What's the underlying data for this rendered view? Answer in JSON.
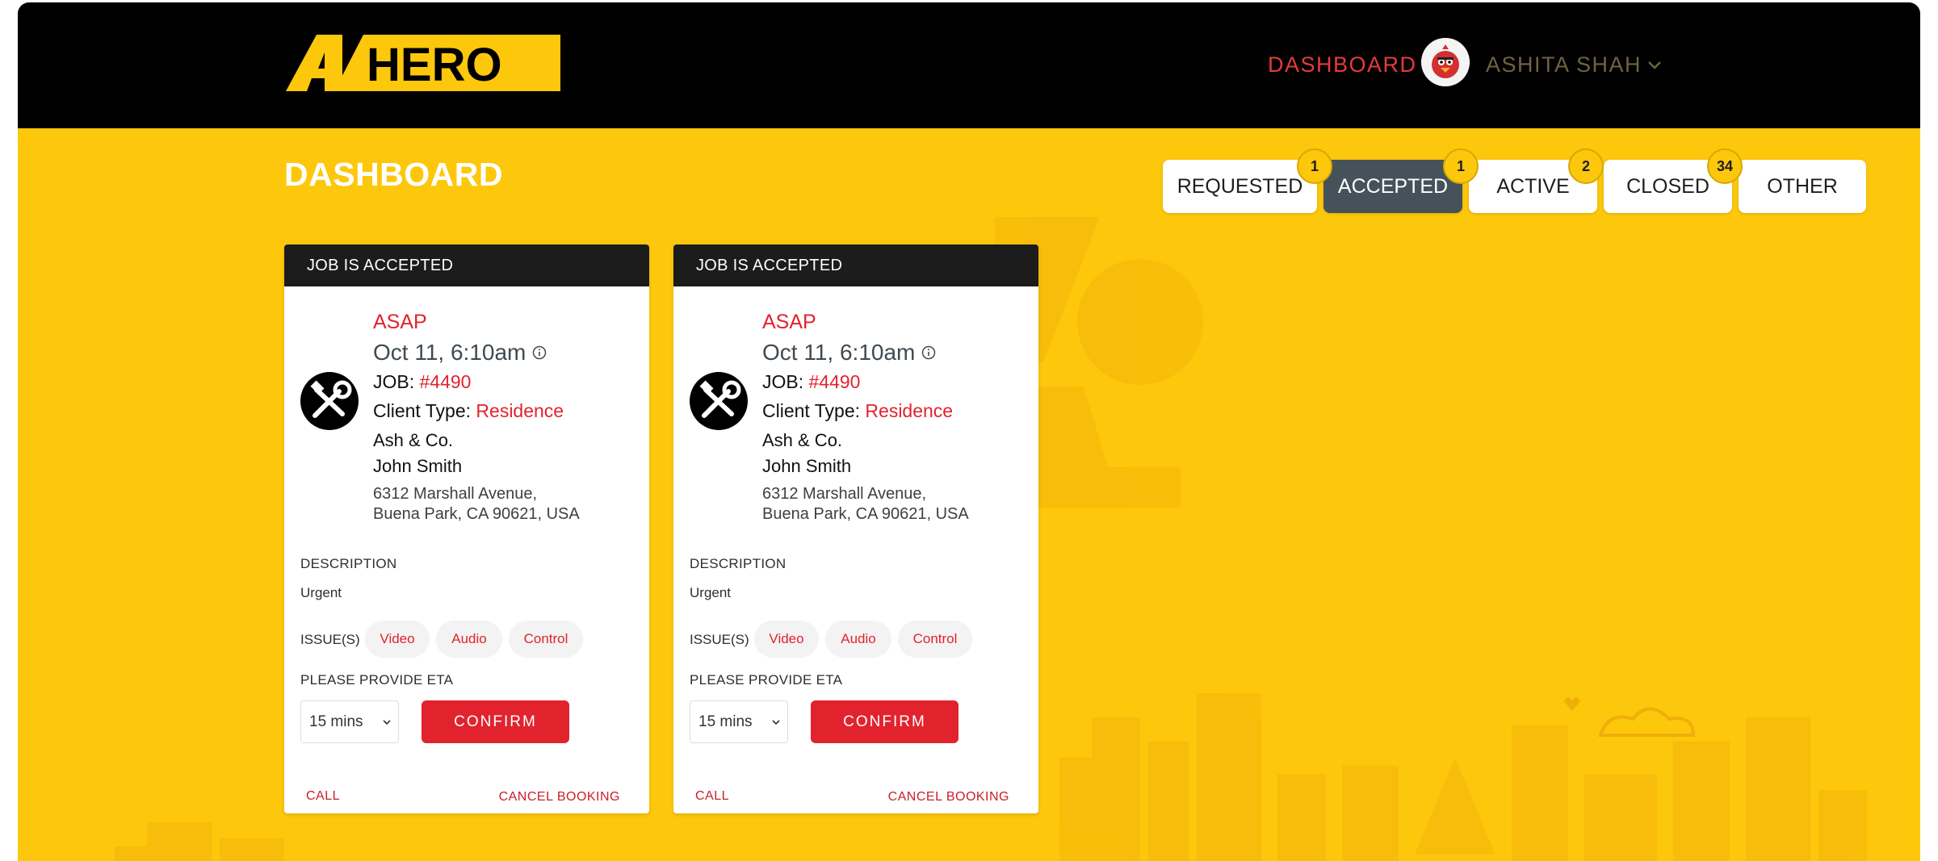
{
  "header": {
    "logo_text": "AV HERO",
    "nav_dashboard": "DASHBOARD",
    "user_name": "ASHITA SHAH"
  },
  "page": {
    "title": "DASHBOARD"
  },
  "tabs": [
    {
      "label": "REQUESTED",
      "badge": "1",
      "active": false
    },
    {
      "label": "ACCEPTED",
      "badge": "1",
      "active": true
    },
    {
      "label": "ACTIVE",
      "badge": "2",
      "active": false
    },
    {
      "label": "CLOSED",
      "badge": "34",
      "active": false
    },
    {
      "label": "OTHER",
      "badge": "",
      "active": false
    }
  ],
  "cards": [
    {
      "status": "JOB IS ACCEPTED",
      "timing": "ASAP",
      "datetime": "Oct 11, 6:10am",
      "job_label": "JOB:",
      "job_number": "#4490",
      "client_type_label": "Client Type:",
      "client_type": "Residence",
      "company": "Ash & Co.",
      "contact": "John Smith",
      "address_line1": "6312 Marshall Avenue,",
      "address_line2": "Buena Park, CA 90621, USA",
      "description_label": "DESCRIPTION",
      "description": "Urgent",
      "issues_label": "ISSUE(S)",
      "issues": [
        "Video",
        "Audio",
        "Control"
      ],
      "eta_label": "PLEASE PROVIDE ETA",
      "eta_value": "15 mins",
      "confirm_label": "CONFIRM",
      "call_label": "CALL",
      "cancel_label": "CANCEL BOOKING"
    },
    {
      "status": "JOB IS ACCEPTED",
      "timing": "ASAP",
      "datetime": "Oct 11, 6:10am",
      "job_label": "JOB:",
      "job_number": "#4490",
      "client_type_label": "Client Type:",
      "client_type": "Residence",
      "company": "Ash & Co.",
      "contact": "John Smith",
      "address_line1": "6312 Marshall Avenue,",
      "address_line2": "Buena Park, CA 90621, USA",
      "description_label": "DESCRIPTION",
      "description": "Urgent",
      "issues_label": "ISSUE(S)",
      "issues": [
        "Video",
        "Audio",
        "Control"
      ],
      "eta_label": "PLEASE PROVIDE ETA",
      "eta_value": "15 mins",
      "confirm_label": "CONFIRM",
      "call_label": "CALL",
      "cancel_label": "CANCEL BOOKING"
    }
  ],
  "colors": {
    "brand_yellow": "#fdc70c",
    "header_black": "#000000",
    "accent_red": "#e2232e",
    "active_tab": "#46525a"
  }
}
